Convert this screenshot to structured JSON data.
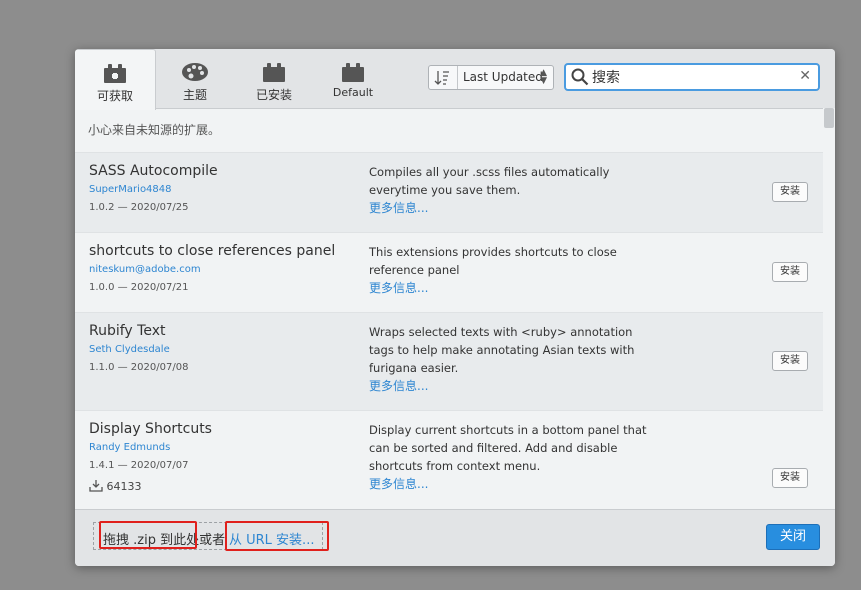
{
  "tabs": [
    {
      "label": "可获取",
      "icon": "puzzle-icon",
      "active": true
    },
    {
      "label": "主题",
      "icon": "palette-icon",
      "active": false
    },
    {
      "label": "已安装",
      "icon": "puzzle-icon",
      "active": false
    },
    {
      "label": "Default",
      "icon": "puzzle-icon",
      "active": false
    }
  ],
  "sort": {
    "label": "Last Updated",
    "icon": "sort-icon"
  },
  "search": {
    "value": "搜索",
    "placeholder": "搜索",
    "icon": "search-icon",
    "clear_icon": "close-icon"
  },
  "warning": "小心来自未知源的扩展。",
  "extensions": [
    {
      "name": "SASS Autocompile",
      "author": "SuperMario4848",
      "version": "1.0.2 — 2020/07/25",
      "description": "Compiles all your .scss files automatically everytime you save them.",
      "more": "更多信息...",
      "install_label": "安装"
    },
    {
      "name": "shortcuts to close references panel",
      "author": "niteskum@adobe.com",
      "version": "1.0.0 — 2020/07/21",
      "description": "This extensions provides shortcuts to close reference panel",
      "more": "更多信息...",
      "install_label": "安装"
    },
    {
      "name": "Rubify Text",
      "author": "Seth Clydesdale",
      "version": "1.1.0 — 2020/07/08",
      "description": "Wraps selected texts with <ruby> annotation tags to help make annotating Asian texts with furigana easier.",
      "more": "更多信息...",
      "install_label": "安装"
    },
    {
      "name": "Display Shortcuts",
      "author": "Randy Edmunds",
      "version": "1.4.1 — 2020/07/07",
      "downloads": "64133",
      "description": "Display current shortcuts in a bottom panel that can be sorted and filtered. Add and disable shortcuts from context menu.",
      "more": "更多信息...",
      "install_label": "安装"
    }
  ],
  "footer": {
    "drop_text": "拖拽 .zip 到此处或者",
    "url_link": "从 URL 安装...",
    "close_label": "关闭"
  },
  "colors": {
    "accent": "#288edf",
    "link": "#2e86d1",
    "highlight": "#e0201c"
  }
}
